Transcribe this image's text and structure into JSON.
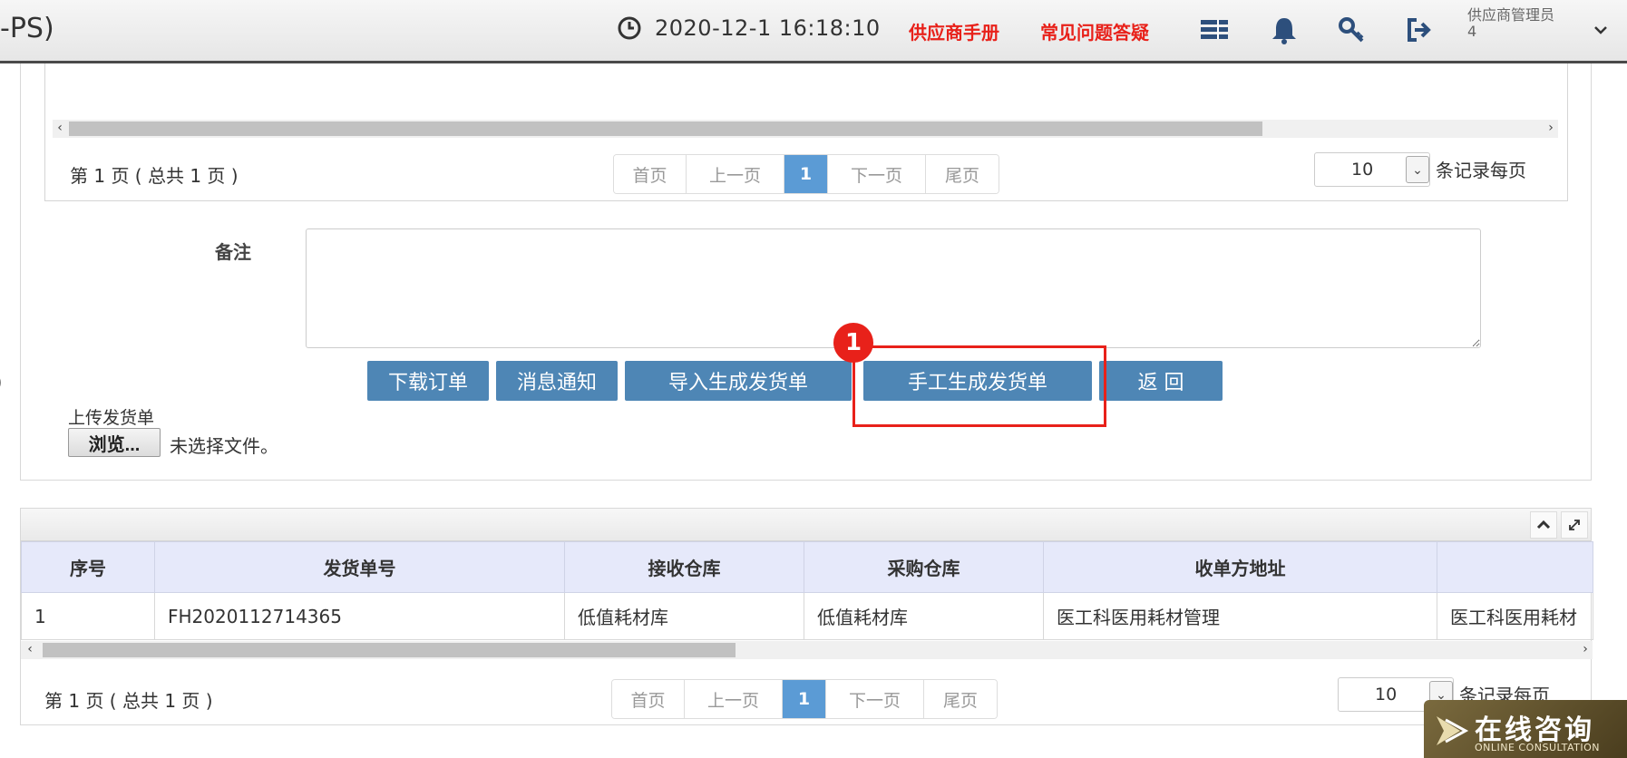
{
  "header": {
    "app_title_fragment": "-PS)",
    "datetime": "2020-12-1  16:18:10",
    "link_manual": "供应商手册",
    "link_faq": "常见问题答疑",
    "user_name": "供应商管理员",
    "user_sub": "4",
    "icons": [
      "clock-icon",
      "list-icon",
      "bell-icon",
      "key-icon",
      "logout-icon",
      "chevron-down-icon"
    ]
  },
  "upper": {
    "pager": {
      "info": "第 1 页 ( 总共 1 页 )",
      "first": "首页",
      "prev": "上一页",
      "current": "1",
      "next": "下一页",
      "last": "尾页",
      "page_size": "10",
      "per_page": "条记录每页"
    },
    "remark_label": "备注",
    "remark_value": "",
    "buttons": {
      "download_order": "下载订单",
      "notify": "消息通知",
      "import_generate": "导入生成发货单",
      "manual_generate": "手工生成发货单",
      "back": "返 回"
    },
    "step_badge": "1",
    "upload_label": "上传发货单",
    "browse": "浏览...",
    "no_file": "未选择文件。",
    "left_edge_paren": ")"
  },
  "lower": {
    "columns": [
      "序号",
      "发货单号",
      "接收仓库",
      "采购仓库",
      "收单方地址",
      ""
    ],
    "rows": [
      [
        "1",
        "FH2020112714365",
        "低值耗材库",
        "低值耗材库",
        "医工科医用耗材管理",
        "医工科医用耗材"
      ]
    ],
    "pager": {
      "info": "第 1 页 ( 总共 1 页 )",
      "first": "首页",
      "prev": "上一页",
      "current": "1",
      "next": "下一页",
      "last": "尾页",
      "page_size": "10",
      "per_page": "条记录每页"
    }
  },
  "consult": {
    "cn": "在线咨询",
    "en": "ONLINE CONSULTATION"
  },
  "colors": {
    "accent_button": "#4e86b5",
    "highlight": "#e8211a",
    "pager_active": "#5b9bd5",
    "table_header": "#e6e9fa"
  }
}
